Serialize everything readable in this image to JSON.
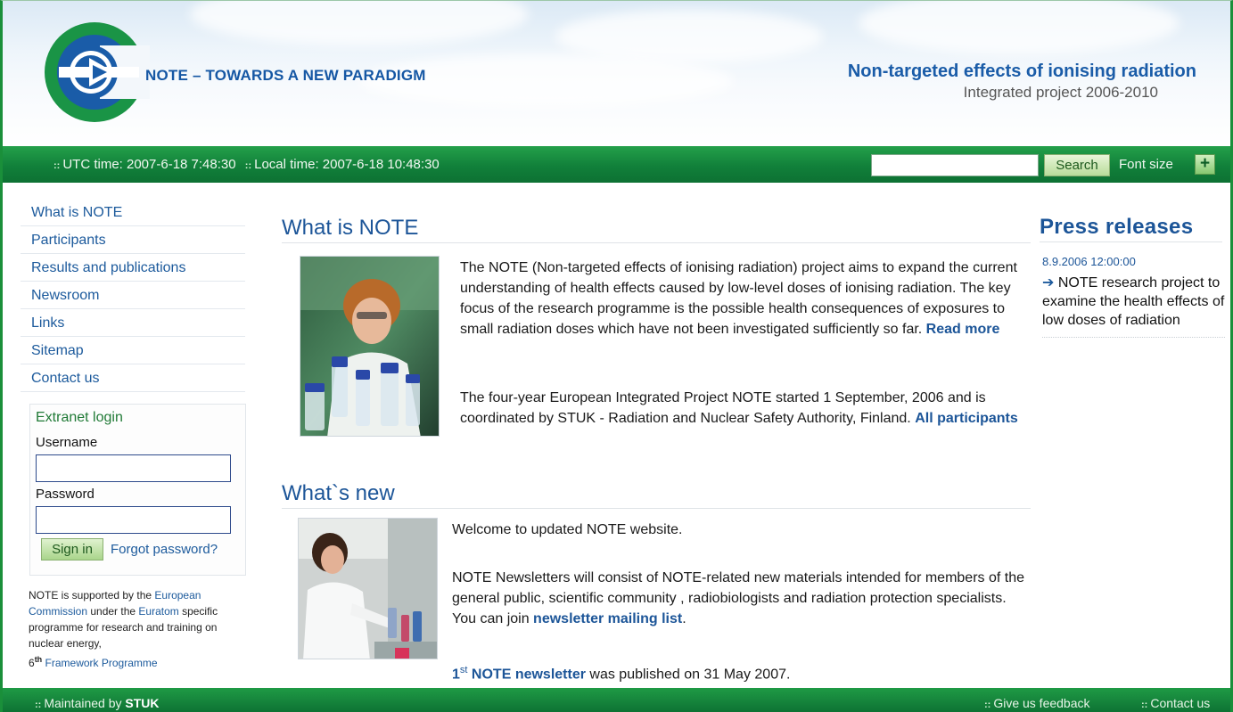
{
  "header": {
    "brand_text": "NOTE – TOWARDS A NEW PARADIGM",
    "title": "Non-targeted effects of ionising radiation",
    "subtitle": "Integrated project 2006-2010"
  },
  "topbar": {
    "utc_time": "UTC time: 2007-6-18 7:48:30",
    "local_time": "Local time: 2007-6-18 10:48:30",
    "search_value": "",
    "search_button": "Search",
    "font_size_label": "Font size",
    "font_size_plus": "+"
  },
  "nav": {
    "items": [
      {
        "label": "What is NOTE"
      },
      {
        "label": "Participants"
      },
      {
        "label": "Results and publications"
      },
      {
        "label": "Newsroom"
      },
      {
        "label": "Links"
      },
      {
        "label": "Sitemap"
      },
      {
        "label": "Contact us"
      }
    ]
  },
  "login": {
    "title": "Extranet login",
    "username_label": "Username",
    "username_value": "",
    "password_label": "Password",
    "password_value": "",
    "signin_button": "Sign in",
    "forgot_link": "Forgot password?"
  },
  "support": {
    "text1": "NOTE is supported by the ",
    "link1": "European Commission",
    "text2": " under the ",
    "link2": "Euratom",
    "text3": " specific programme for research and training on nuclear energy,",
    "sixth": "6",
    "th": "th",
    "link3": "Framework Programme"
  },
  "what_is_note": {
    "title": "What is NOTE",
    "para1": "The NOTE (Non-targeted effects of ionising radiation) project aims to expand the current understanding of health effects caused by low-level doses of ionising radiation. The key focus of the research programme is the possible health consequences of exposures to small radiation doses which have not been investigated sufficiently so far. ",
    "read_more": "Read more",
    "para2": "The four-year European Integrated Project NOTE started 1 September, 2006 and is coordinated by STUK - Radiation and Nuclear Safety Authority, Finland. ",
    "all_participants": "All participants"
  },
  "whats_new": {
    "title": "What`s new",
    "para1": "Welcome to updated NOTE website.",
    "para2": "NOTE Newsletters will consist of NOTE-related new materials intended for members of the general public, scientific community , radiobiologists and radiation protection specialists. You can join ",
    "mailing_list_link": "newsletter mailing list",
    "para2_end": ".",
    "first": "1",
    "st": "st",
    "newsletter_link": "NOTE newsletter",
    "para3": " was published on 31 May 2007."
  },
  "press": {
    "title": "Press releases",
    "date": "8.9.2006 12:00:00",
    "item": "NOTE research project to examine the health effects of low doses of radiation"
  },
  "footer": {
    "maintained_by": "Maintained by ",
    "stuk": "STUK",
    "feedback": "Give us feedback",
    "contact": "Contact us"
  },
  "colors": {
    "brand_green": "#1a8f3a",
    "link_blue": "#1c5598"
  }
}
